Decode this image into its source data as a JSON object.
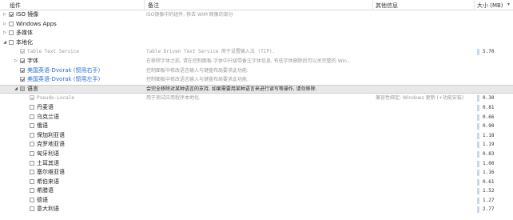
{
  "columns": {
    "component": "组件",
    "note": "备注",
    "other_info": "其他信息",
    "size": "大小 (MB)"
  },
  "rows": [
    {
      "level": 0,
      "expander": "collapsed",
      "check": "checked",
      "name": "ISO 镜像",
      "style": "normal",
      "desc": "ISO镜像中的组件, 移去 WIM 映像的部分",
      "desc_style": "gray",
      "info": "",
      "size": "",
      "bar": false
    },
    {
      "level": 0,
      "expander": "collapsed",
      "check": "none",
      "name": "Windows Apps",
      "style": "normal",
      "desc": "",
      "desc_style": "gray",
      "info": "",
      "size": "",
      "bar": false
    },
    {
      "level": 0,
      "expander": "collapsed",
      "check": "none",
      "name": "多媒体",
      "style": "normal",
      "desc": "",
      "desc_style": "gray",
      "info": "",
      "size": "",
      "bar": false
    },
    {
      "level": 0,
      "expander": "expanded",
      "check": "none",
      "name": "本地化",
      "style": "normal",
      "desc": "",
      "desc_style": "gray",
      "info": "",
      "size": "",
      "bar": false
    },
    {
      "level": 1,
      "expander": "none",
      "check": "disabled-checked",
      "name": "Table Text Service",
      "style": "gray",
      "desc": "Table Driven Text Service 用于设置输入法 (TIP).",
      "desc_style": "gray-mono",
      "info": "",
      "size": "5.70",
      "bar": true
    },
    {
      "level": 1,
      "expander": "collapsed",
      "check": "checked",
      "name": "字体",
      "style": "normal",
      "desc": "在移除字体之前, 请在控制面板-字体中升级带备注字体信息, 有些字体删除后可以关完整的 Win...",
      "desc_style": "gray",
      "info": "",
      "size": "",
      "bar": false
    },
    {
      "level": 1,
      "expander": "none",
      "check": "checked",
      "name": "美国英语-Dvorak (惯用右手)",
      "style": "link",
      "desc": "控制面板中修改语言输入与键盘布局要求此功能.",
      "desc_style": "gray",
      "info": "",
      "size": "",
      "bar": false
    },
    {
      "level": 1,
      "expander": "none",
      "check": "checked",
      "name": "美国英语-Dvorak (惯用左手)",
      "style": "link",
      "desc": "控制面板中修改语言输入与键盘布局要求此功能.",
      "desc_style": "gray",
      "info": "",
      "size": "",
      "bar": false
    },
    {
      "level": 1,
      "expander": "expanded",
      "check": "partial",
      "name": "语言",
      "style": "normal",
      "desc": "会完全移除对某种语言的支持, 如果需要用某种语言来进行读写等操作, 请勿移除.",
      "desc_style": "dark",
      "info": "",
      "size": "",
      "bar": false,
      "selected": true
    },
    {
      "level": 2,
      "expander": "none",
      "check": "disabled-checked",
      "name": "Pseudo-Locale",
      "style": "gray",
      "desc": "用于测试应用程序本地化.",
      "desc_style": "gray",
      "info": "兼容性绑定: Windows 更新 (+功能安装)",
      "size": "0.30",
      "bar": true
    },
    {
      "level": 2,
      "expander": "none",
      "check": "none",
      "name": "丹麦语",
      "style": "normal",
      "desc": "",
      "desc_style": "gray",
      "info": "",
      "size": "0.81",
      "bar": true
    },
    {
      "level": 2,
      "expander": "none",
      "check": "none",
      "name": "乌克兰语",
      "style": "normal",
      "desc": "",
      "desc_style": "gray",
      "info": "",
      "size": "0.66",
      "bar": true
    },
    {
      "level": 2,
      "expander": "none",
      "check": "none",
      "name": "俄语",
      "style": "normal",
      "desc": "",
      "desc_style": "gray",
      "info": "",
      "size": "0.90",
      "bar": true
    },
    {
      "level": 2,
      "expander": "none",
      "check": "none",
      "name": "保加利亚语",
      "style": "normal",
      "desc": "",
      "desc_style": "gray",
      "info": "",
      "size": "1.18",
      "bar": true
    },
    {
      "level": 2,
      "expander": "none",
      "check": "none",
      "name": "克罗地亚语",
      "style": "normal",
      "desc": "",
      "desc_style": "gray",
      "info": "",
      "size": "1.19",
      "bar": true
    },
    {
      "level": 2,
      "expander": "none",
      "check": "none",
      "name": "匈牙利语",
      "style": "normal",
      "desc": "",
      "desc_style": "gray",
      "info": "",
      "size": "0.83",
      "bar": true
    },
    {
      "level": 2,
      "expander": "none",
      "check": "none",
      "name": "土耳其语",
      "style": "normal",
      "desc": "",
      "desc_style": "gray",
      "info": "",
      "size": "1.00",
      "bar": true
    },
    {
      "level": 2,
      "expander": "none",
      "check": "none",
      "name": "塞尔维亚语",
      "style": "normal",
      "desc": "",
      "desc_style": "gray",
      "info": "",
      "size": "1.16",
      "bar": true
    },
    {
      "level": 2,
      "expander": "none",
      "check": "none",
      "name": "希伯来语",
      "style": "normal",
      "desc": "",
      "desc_style": "gray",
      "info": "",
      "size": "0.61",
      "bar": true
    },
    {
      "level": 2,
      "expander": "none",
      "check": "none",
      "name": "希腊语",
      "style": "normal",
      "desc": "",
      "desc_style": "gray",
      "info": "",
      "size": "1.52",
      "bar": true
    },
    {
      "level": 2,
      "expander": "none",
      "check": "none",
      "name": "德语",
      "style": "normal",
      "desc": "",
      "desc_style": "gray",
      "info": "",
      "size": "1.27",
      "bar": true
    },
    {
      "level": 2,
      "expander": "none",
      "check": "none",
      "name": "意大利语",
      "style": "normal",
      "desc": "",
      "desc_style": "gray",
      "info": "",
      "size": "2.77",
      "bar": true
    }
  ],
  "colors": {
    "link": "#2b6fd6",
    "selected_row": "#e8e8e8",
    "size_bar": "#c9d7ea"
  }
}
